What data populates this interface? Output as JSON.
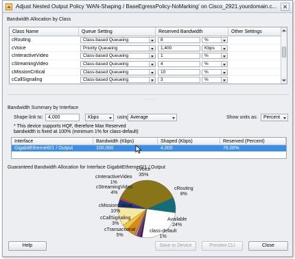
{
  "window": {
    "title": "Adjust Nested Output Policy 'WAN-Shaping / BaseEgressPolicy-NoMarking' on Cisco_2921.yourdomain.c..."
  },
  "allocation": {
    "section_label": "Bandwidth Allocation by Class",
    "columns": [
      "Class Name",
      "Queue Setting",
      "Reserved Bandwidth",
      "Other Settings"
    ],
    "rows": [
      {
        "name": "cRouting",
        "queue": "Class-based Queueing",
        "value": "8",
        "unit": "%"
      },
      {
        "name": "cVoice",
        "queue": "Priority Queueing",
        "value": "1,400",
        "unit": "Kbps"
      },
      {
        "name": "cInteractiveVideo",
        "queue": "Class-based Queueing",
        "value": "1",
        "unit": "%"
      },
      {
        "name": "cStreamingVideo",
        "queue": "Class-based Queueing",
        "value": "4",
        "unit": "%"
      },
      {
        "name": "cMissionCritical",
        "queue": "Class-based Queueing",
        "value": "10",
        "unit": "%"
      },
      {
        "name": "cCallSignaling",
        "queue": "Class-based Queueing",
        "value": "3",
        "unit": "%"
      }
    ]
  },
  "summary": {
    "section_label": "Bandwidth Summary by Interface",
    "shape_link_label": "Shape link to:",
    "shape_value": "4,000",
    "shape_unit": "Kbps",
    "using_label": "using",
    "using_value": "Average",
    "units_label": "Show units as:",
    "units_value": "Percent",
    "note_line1": "* This device supports HQF, therefore Max Reserved",
    "note_line2": "bandwidth is fixed at 100% (minimum 1% for class-default)",
    "columns": [
      "Interface",
      "Bandwidth (Kbps)",
      "Shaped (Kbps)",
      "Reserved (Percent)"
    ],
    "row": {
      "interface": "GigabitEthernet0/1 / Output",
      "bandwidth": "100,000",
      "shaped": "4,000",
      "reserved": "76.00%"
    }
  },
  "chart": {
    "title": "Guaranteed Bandwidth Allocation for Interface GigabitEthernet0/1 / Output"
  },
  "chart_data": {
    "type": "pie",
    "title": "Guaranteed Bandwidth Allocation for Interface GigabitEthernet0/1 / Output",
    "slices": [
      {
        "label": "cVoice",
        "value": 35,
        "color": "#8a7418"
      },
      {
        "label": "cRouting",
        "value": 8,
        "color": "#0f6e78"
      },
      {
        "label": "Available",
        "value": 24,
        "color": "#ffffff"
      },
      {
        "label": "class-default",
        "value": 1,
        "color": "#0f1a8a"
      },
      {
        "label": "",
        "value": 1,
        "color": "#b01e1e"
      },
      {
        "label": "",
        "value": 1,
        "color": "#6e2e8a"
      },
      {
        "label": "",
        "value": 1,
        "color": "#9b9b9b"
      },
      {
        "label": "cTransactional",
        "value": 5,
        "color": "#d98a18"
      },
      {
        "label": "cCallSignaling",
        "value": 3,
        "color": "#f2c640"
      },
      {
        "label": "cMissionCritical",
        "value": 10,
        "color": "#f6e8a0"
      },
      {
        "label": "cStreamingVideo",
        "value": 4,
        "color": "#1a3a8a"
      },
      {
        "label": "cInteractiveVideo",
        "value": 1,
        "color": "#c8362a"
      }
    ],
    "labels": [
      {
        "text": "cVoice",
        "value": "35%"
      },
      {
        "text": "cRouting",
        "value": "8%"
      },
      {
        "text": "Available",
        "value": "24%"
      },
      {
        "text": "class-default",
        "value": "1%"
      },
      {
        "text": "cTransactional",
        "value": "5%"
      },
      {
        "text": "cCallSignaling",
        "value": "3%"
      },
      {
        "text": "cMissionCritical",
        "value": "10%"
      },
      {
        "text": "cStreamingVideo",
        "value": "4%"
      },
      {
        "text": "cInteractiveVideo",
        "value": "1%"
      }
    ]
  },
  "buttons": {
    "help": "Help",
    "save": "Save to Device",
    "preview": "Preview CLI",
    "close": "Close"
  },
  "colors": {
    "selection": "#3d8ee6",
    "window_bg": "#eceef1"
  }
}
